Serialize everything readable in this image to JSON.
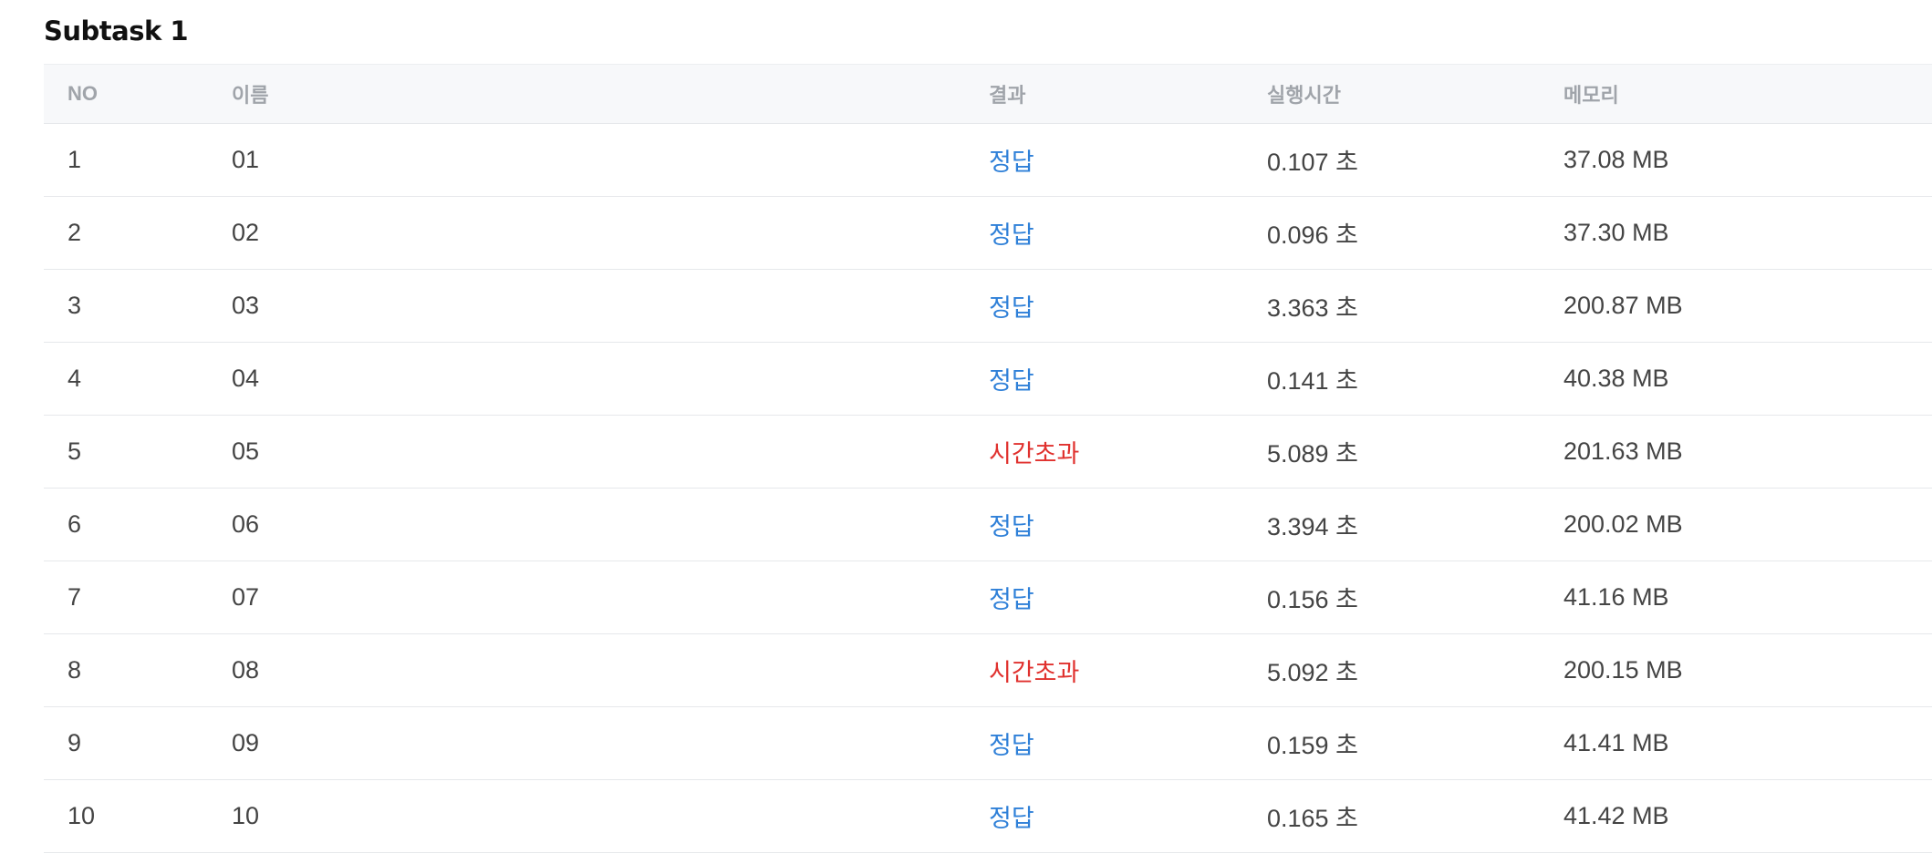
{
  "subtask_title": "Subtask 1",
  "colors": {
    "accepted": "#2f80d8",
    "time_limit_exceeded": "#e0312e",
    "header_bg": "#f7f8fa",
    "header_text": "#a0a4aa"
  },
  "table": {
    "headers": {
      "no": "NO",
      "name": "이름",
      "result": "결과",
      "time": "실행시간",
      "memory": "메모리"
    },
    "rows": [
      {
        "no": "1",
        "name": "01",
        "result": "정답",
        "status": "ac",
        "time": "0.107 초",
        "memory": "37.08 MB"
      },
      {
        "no": "2",
        "name": "02",
        "result": "정답",
        "status": "ac",
        "time": "0.096 초",
        "memory": "37.30 MB"
      },
      {
        "no": "3",
        "name": "03",
        "result": "정답",
        "status": "ac",
        "time": "3.363 초",
        "memory": "200.87 MB"
      },
      {
        "no": "4",
        "name": "04",
        "result": "정답",
        "status": "ac",
        "time": "0.141 초",
        "memory": "40.38 MB"
      },
      {
        "no": "5",
        "name": "05",
        "result": "시간초과",
        "status": "tle",
        "time": "5.089 초",
        "memory": "201.63 MB"
      },
      {
        "no": "6",
        "name": "06",
        "result": "정답",
        "status": "ac",
        "time": "3.394 초",
        "memory": "200.02 MB"
      },
      {
        "no": "7",
        "name": "07",
        "result": "정답",
        "status": "ac",
        "time": "0.156 초",
        "memory": "41.16 MB"
      },
      {
        "no": "8",
        "name": "08",
        "result": "시간초과",
        "status": "tle",
        "time": "5.092 초",
        "memory": "200.15 MB"
      },
      {
        "no": "9",
        "name": "09",
        "result": "정답",
        "status": "ac",
        "time": "0.159 초",
        "memory": "41.41 MB"
      },
      {
        "no": "10",
        "name": "10",
        "result": "정답",
        "status": "ac",
        "time": "0.165 초",
        "memory": "41.42 MB"
      }
    ]
  }
}
